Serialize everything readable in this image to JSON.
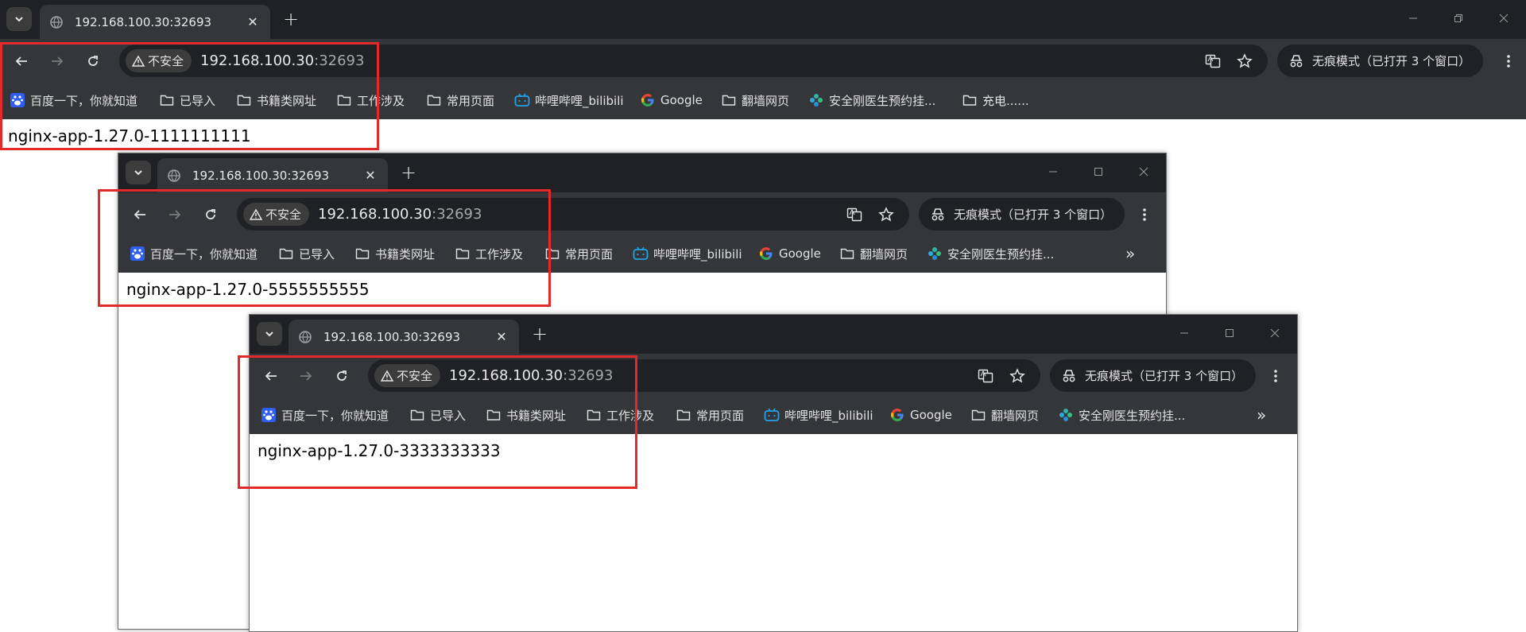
{
  "windows": [
    {
      "id": "w1",
      "tab_title": "192.168.100.30:32693",
      "security_label": "不安全",
      "url_host": "192.168.100.30",
      "url_port": ":32693",
      "incognito_label": "无痕模式（已打开 3 个窗口）",
      "bookmarks": [
        {
          "label": "百度一下，你就知道",
          "icon": "baidu-icon"
        },
        {
          "label": "已导入",
          "icon": "folder-icon"
        },
        {
          "label": "书籍类网址",
          "icon": "folder-icon"
        },
        {
          "label": "工作涉及",
          "icon": "folder-icon"
        },
        {
          "label": "常用页面",
          "icon": "folder-icon"
        },
        {
          "label": "哔哩哔哩_bilibili",
          "icon": "bilibili-icon"
        },
        {
          "label": "Google",
          "icon": "google-icon"
        },
        {
          "label": "翻墙网页",
          "icon": "folder-icon"
        },
        {
          "label": "安全刚医生预约挂...",
          "icon": "clinic-icon"
        },
        {
          "label": "充电......",
          "icon": "folder-icon"
        }
      ],
      "content_text": "nginx-app-1.27.0-1111111111"
    },
    {
      "id": "w2",
      "tab_title": "192.168.100.30:32693",
      "security_label": "不安全",
      "url_host": "192.168.100.30",
      "url_port": ":32693",
      "incognito_label": "无痕模式（已打开 3 个窗口）",
      "bookmarks": [
        {
          "label": "百度一下，你就知道",
          "icon": "baidu-icon"
        },
        {
          "label": "已导入",
          "icon": "folder-icon"
        },
        {
          "label": "书籍类网址",
          "icon": "folder-icon"
        },
        {
          "label": "工作涉及",
          "icon": "folder-icon"
        },
        {
          "label": "常用页面",
          "icon": "folder-icon"
        },
        {
          "label": "哔哩哔哩_bilibili",
          "icon": "bilibili-icon"
        },
        {
          "label": "Google",
          "icon": "google-icon"
        },
        {
          "label": "翻墙网页",
          "icon": "folder-icon"
        },
        {
          "label": "安全刚医生预约挂...",
          "icon": "clinic-icon"
        }
      ],
      "overflow_label": "»",
      "content_text": "nginx-app-1.27.0-5555555555"
    },
    {
      "id": "w3",
      "tab_title": "192.168.100.30:32693",
      "security_label": "不安全",
      "url_host": "192.168.100.30",
      "url_port": ":32693",
      "incognito_label": "无痕模式（已打开 3 个窗口）",
      "bookmarks": [
        {
          "label": "百度一下，你就知道",
          "icon": "baidu-icon"
        },
        {
          "label": "已导入",
          "icon": "folder-icon"
        },
        {
          "label": "书籍类网址",
          "icon": "folder-icon"
        },
        {
          "label": "工作涉及",
          "icon": "folder-icon"
        },
        {
          "label": "常用页面",
          "icon": "folder-icon"
        },
        {
          "label": "哔哩哔哩_bilibili",
          "icon": "bilibili-icon"
        },
        {
          "label": "Google",
          "icon": "google-icon"
        },
        {
          "label": "翻墙网页",
          "icon": "folder-icon"
        },
        {
          "label": "安全刚医生预约挂...",
          "icon": "clinic-icon"
        }
      ],
      "overflow_label": "»",
      "content_text": "nginx-app-1.27.0-3333333333"
    }
  ],
  "colors": {
    "chrome_dark": "#202124",
    "toolbar": "#35363a",
    "annotation_red": "#e32a2a"
  }
}
